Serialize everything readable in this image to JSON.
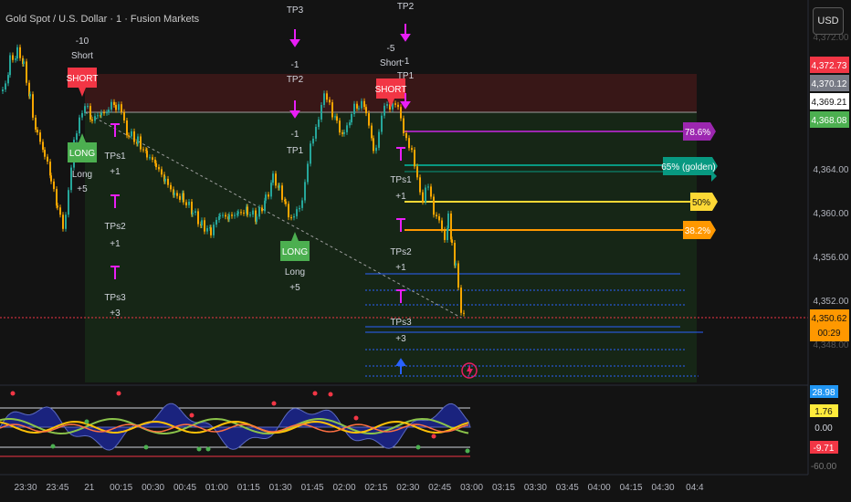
{
  "header": {
    "title": "Gold Spot / U.S. Dollar · 1 · Fusion Markets",
    "currency": "USD"
  },
  "price_axis": {
    "ticks": [
      "4,364.00",
      "4,360.00",
      "4,356.00",
      "4,352.00",
      "4,348.00"
    ],
    "top_partial": "4,372.00",
    "badges": [
      {
        "label": "4,372.73",
        "color": "#f23645",
        "text_color": "#ffffff"
      },
      {
        "label": "4,370.12",
        "color": "#787b86",
        "text_color": "#ffffff"
      },
      {
        "label": "4,369.21",
        "color": "#ffffff",
        "text_color": "#131313"
      },
      {
        "label": "4,368.08",
        "color": "#4caf50",
        "text_color": "#ffffff"
      },
      {
        "label": "4,350.62",
        "color": "#ff9800",
        "text_color": "#131313"
      }
    ],
    "countdown": "00:29"
  },
  "osc_axis": {
    "badges": [
      {
        "label": "28.98",
        "color": "#2196f3",
        "text_color": "#ffffff"
      },
      {
        "label": "1.76",
        "color": "#ffeb3b",
        "text_color": "#131313"
      },
      {
        "label": "0.00",
        "color": "#131313",
        "text_color": "#d1d4dc"
      },
      {
        "label": "-9.71",
        "color": "#f23645",
        "text_color": "#ffffff"
      }
    ],
    "bottom_partial": "-60.00"
  },
  "time_axis": [
    "23:30",
    "23:45",
    "21",
    "00:15",
    "00:30",
    "00:45",
    "01:00",
    "01:15",
    "01:30",
    "01:45",
    "02:00",
    "02:15",
    "02:30",
    "02:45",
    "03:00",
    "03:15",
    "03:30",
    "03:45",
    "04:00",
    "04:15",
    "04:30",
    "04:4"
  ],
  "fib_levels": [
    {
      "label": "78.6%",
      "color": "#9c27b0",
      "text_color": "#ffffff"
    },
    {
      "label": "65% (golden)",
      "color": "#089981",
      "text_color": "#ffffff"
    },
    {
      "label": "50%",
      "color": "#fdd835",
      "text_color": "#131313"
    },
    {
      "label": "38.2%",
      "color": "#ff9800",
      "text_color": "#ffffff"
    }
  ],
  "signals": {
    "short1": {
      "label": "SHORT",
      "above": [
        "-10",
        "Short"
      ]
    },
    "short2": {
      "label": "SHORT",
      "above": [
        "-5",
        "Short"
      ]
    },
    "long1": {
      "label": "LONG",
      "below": [
        "Long",
        "+5"
      ]
    },
    "long2": {
      "label": "LONG",
      "below": [
        "Long",
        "+5"
      ]
    }
  },
  "targets": {
    "short_set1": [
      {
        "label": "TP3",
        "value": ""
      },
      {
        "label": "TP2",
        "value": "-1"
      },
      {
        "label": "TP1",
        "value": "-1"
      }
    ],
    "short_set2": [
      {
        "label": "TP2",
        "value": ""
      },
      {
        "label": "TP1",
        "value": "-1"
      }
    ],
    "long_set1": [
      {
        "label": "TPs1",
        "value": "+1"
      },
      {
        "label": "TPs2",
        "value": "+1"
      },
      {
        "label": "TPs3",
        "value": "+3"
      }
    ],
    "long_set2": [
      {
        "label": "TPs1",
        "value": "+1"
      },
      {
        "label": "TPs2",
        "value": "+1"
      },
      {
        "label": "TPs3",
        "value": "+3"
      }
    ]
  },
  "colors": {
    "background": "#131313",
    "bull": "#26a69a",
    "bear": "#f7a600",
    "signal_short": "#f23645",
    "signal_long": "#4caf50",
    "target_marker": "#e91ef6",
    "zone_red": "#3a1717",
    "zone_green": "#172a17"
  }
}
